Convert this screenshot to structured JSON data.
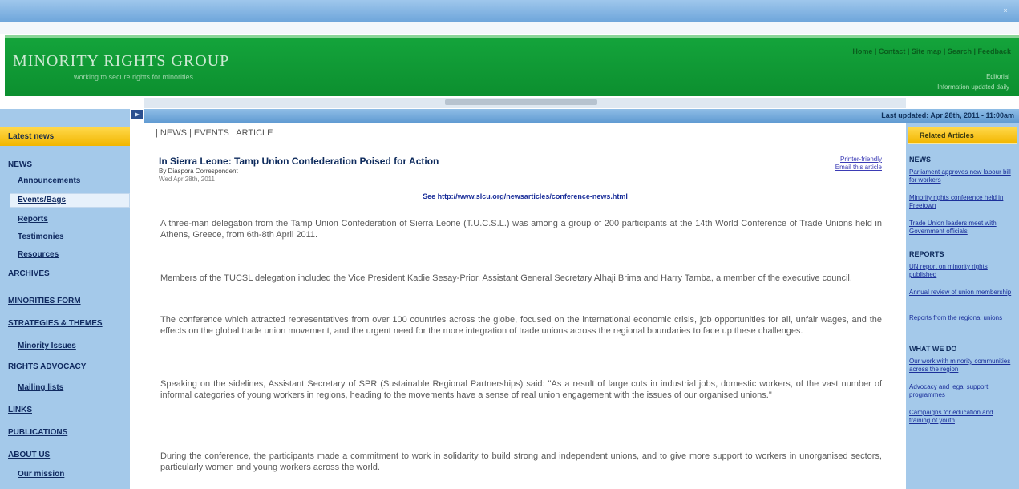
{
  "window": {
    "close_glyph": "×"
  },
  "banner": {
    "logo": "MINORITY RIGHTS GROUP",
    "tagline": "working to secure rights for minorities",
    "top_links": "Home | Contact | Site map | Search | Feedback",
    "sub_info": [
      "Editorial",
      "Information updated daily"
    ]
  },
  "statusbar": {
    "date": "Last updated: Apr 28th, 2011 - 11:00am"
  },
  "left_sidebar": {
    "header": "Latest news",
    "items": [
      {
        "label": "NEWS",
        "indent": false
      },
      {
        "label": "Announcements",
        "indent": true
      },
      {
        "label": "Events/Bags",
        "indent": true,
        "active": true
      },
      {
        "label": "Reports",
        "indent": true
      },
      {
        "label": "Testimonies",
        "indent": true
      },
      {
        "label": "Resources",
        "indent": true
      },
      {
        "label": "ARCHIVES",
        "indent": false
      },
      {
        "label": "MINORITIES FORM",
        "indent": false
      },
      {
        "label": "STRATEGIES & THEMES",
        "indent": false
      },
      {
        "label": "Minority Issues",
        "indent": true
      },
      {
        "label": "RIGHTS ADVOCACY",
        "indent": false
      },
      {
        "label": "Mailing lists",
        "indent": true
      },
      {
        "label": "LINKS",
        "indent": false
      },
      {
        "label": "PUBLICATIONS",
        "indent": false
      },
      {
        "label": "ABOUT US",
        "indent": false
      },
      {
        "label": "Our mission",
        "indent": true
      }
    ]
  },
  "main": {
    "breadcrumb": "| NEWS | EVENTS | ARTICLE",
    "title": "In Sierra Leone: Tamp Union Confederation Poised for Action",
    "byline": "By Diaspora Correspondent",
    "dateline": "Wed Apr 28th, 2011",
    "print_links": [
      "Printer-friendly",
      "Email this article"
    ],
    "web_link": "See http://www.slcu.org/newsarticles/conference-news.html",
    "paragraphs": [
      "A three-man delegation from the Tamp Union Confederation of Sierra Leone (T.U.C.S.L.) was among a group of 200 participants at the 14th World Conference of Trade Unions held in Athens, Greece, from 6th-8th April 2011.",
      "Members of the TUCSL delegation included the Vice President Kadie Sesay-Prior, Assistant General Secretary Alhaji Brima and Harry Tamba, a member of the executive council.",
      "The conference which attracted representatives from over 100 countries across the globe, focused on the international economic crisis, job opportunities for all, unfair wages, and the effects on the global trade union movement, and the urgent need for the more integration of trade unions across the regional boundaries to face up these challenges.",
      "Speaking on the sidelines, Assistant Secretary of SPR (Sustainable Regional Partnerships) said: \"As a result of large cuts in industrial jobs, domestic workers, of the vast number of informal categories of young workers in regions, heading to the movements have a sense of real union engagement with the issues of our organised unions.\"",
      "During the conference, the participants made a commitment to work in solidarity to build strong and independent unions, and to give more support to workers in unorganised sectors, particularly women and young workers across the world."
    ]
  },
  "right_sidebar": {
    "header": "Related Articles",
    "sections": [
      {
        "title": "NEWS",
        "links": [
          "Parliament approves new labour bill for workers",
          "Minority rights conference held in Freetown",
          "Trade Union leaders meet with Government officials"
        ]
      },
      {
        "title": "REPORTS",
        "links": [
          "UN report on minority rights published",
          "Annual review of union membership",
          "Reports from the regional unions"
        ]
      },
      {
        "title": "WHAT WE DO",
        "links": [
          "Our work with minority communities across the region",
          "Advocacy and legal support programmes",
          "Campaigns for education and training of youth"
        ]
      }
    ]
  }
}
